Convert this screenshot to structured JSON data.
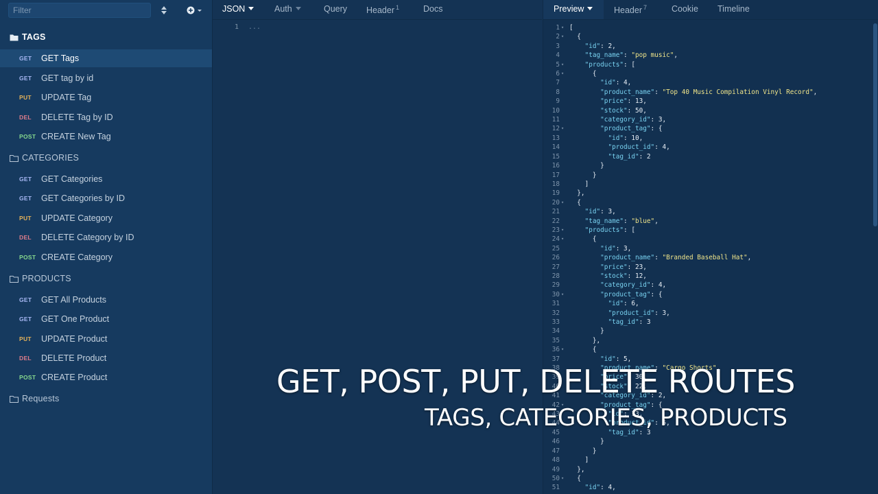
{
  "sidebar": {
    "filter_placeholder": "Filter",
    "folders": [
      {
        "label": "TAGS",
        "open": true
      },
      {
        "label": "CATEGORIES",
        "open": false
      },
      {
        "label": "PRODUCTS",
        "open": false
      },
      {
        "label": "Requests",
        "open": false
      }
    ],
    "requests": [
      {
        "method": "GET",
        "label": "GET Tags",
        "active": true
      },
      {
        "method": "GET",
        "label": "GET tag by id"
      },
      {
        "method": "PUT",
        "label": "UPDATE Tag"
      },
      {
        "method": "DEL",
        "label": "DELETE Tag by ID"
      },
      {
        "method": "POST",
        "label": "CREATE New Tag"
      },
      {
        "method": "GET",
        "label": "GET Categories"
      },
      {
        "method": "GET",
        "label": "GET Categories by ID"
      },
      {
        "method": "PUT",
        "label": "UPDATE Category"
      },
      {
        "method": "DEL",
        "label": "DELETE Category by ID"
      },
      {
        "method": "POST",
        "label": "CREATE Category"
      },
      {
        "method": "GET",
        "label": "GET All Products"
      },
      {
        "method": "GET",
        "label": "GET One Product"
      },
      {
        "method": "PUT",
        "label": "UPDATE Product"
      },
      {
        "method": "DEL",
        "label": "DELETE Product"
      },
      {
        "method": "POST",
        "label": "CREATE Product"
      }
    ]
  },
  "request_tabs": {
    "body": "JSON",
    "auth": "Auth",
    "query": "Query",
    "header": "Header",
    "header_count": "1",
    "docs": "Docs"
  },
  "request_editor": {
    "line": "1",
    "placeholder": "..."
  },
  "response_tabs": {
    "preview": "Preview",
    "header": "Header",
    "header_count": "7",
    "cookie": "Cookie",
    "timeline": "Timeline"
  },
  "response_lines": [
    "[",
    "  {",
    "    \"id\": 2,",
    "    \"tag_name\": \"pop music\",",
    "    \"products\": [",
    "      {",
    "        \"id\": 4,",
    "        \"product_name\": \"Top 40 Music Compilation Vinyl Record\",",
    "        \"price\": 13,",
    "        \"stock\": 50,",
    "        \"category_id\": 3,",
    "        \"product_tag\": {",
    "          \"id\": 10,",
    "          \"product_id\": 4,",
    "          \"tag_id\": 2",
    "        }",
    "      }",
    "    ]",
    "  },",
    "  {",
    "    \"id\": 3,",
    "    \"tag_name\": \"blue\",",
    "    \"products\": [",
    "      {",
    "        \"id\": 3,",
    "        \"product_name\": \"Branded Baseball Hat\",",
    "        \"price\": 23,",
    "        \"stock\": 12,",
    "        \"category_id\": 4,",
    "        \"product_tag\": {",
    "          \"id\": 6,",
    "          \"product_id\": 3,",
    "          \"tag_id\": 3",
    "        }",
    "      },",
    "      {",
    "        \"id\": 5,",
    "        \"product_name\": \"Cargo Shorts\",",
    "        \"price\": 30,",
    "        \"stock\": 22,",
    "        \"category_id\": 2,",
    "        \"product_tag\": {",
    "          \"id\": 13,",
    "          \"product_id\": 5,",
    "          \"tag_id\": 3",
    "        }",
    "      }",
    "    ]",
    "  },",
    "  {",
    "    \"id\": 4,"
  ],
  "overlay": {
    "title": "GET, POST, PUT, DELETE ROUTES",
    "subtitle": "TAGS, CATEGORIES, PRODUCTS"
  }
}
